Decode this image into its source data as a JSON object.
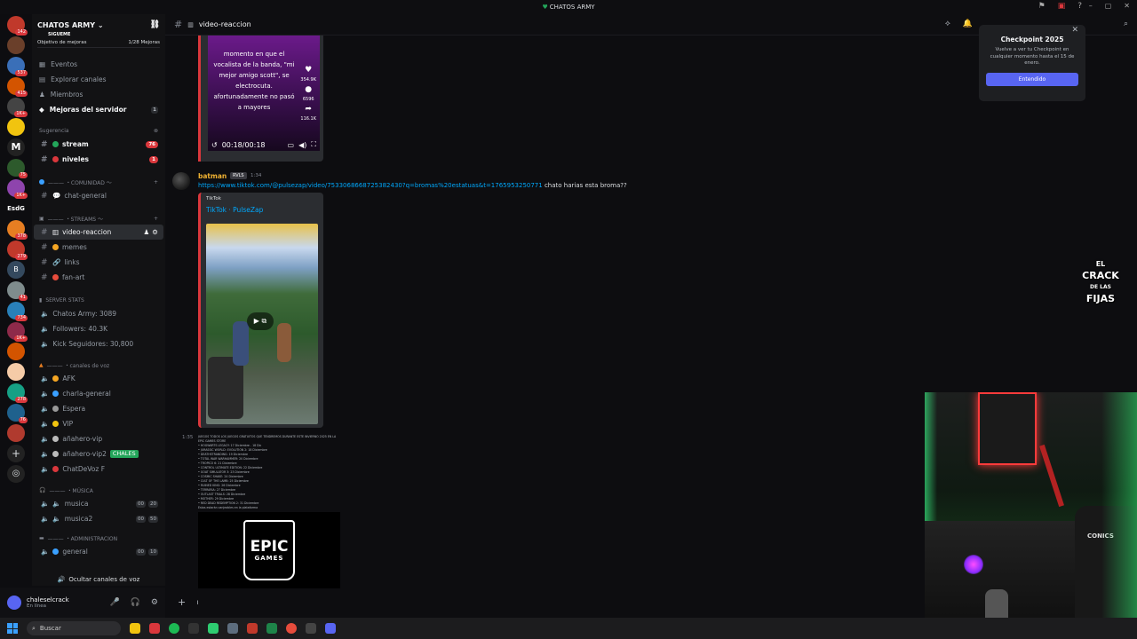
{
  "window": {
    "title": "CHATOS ARMY",
    "title_heart": "♥"
  },
  "server": {
    "name": "CHATOS ARMY",
    "subtitle": "SIGUEME",
    "boost_goal_label": "Objetivo de mejoras",
    "boost_progress": "1/28 Mejoras"
  },
  "rail": {
    "badges": [
      "142",
      "537",
      "415",
      "1K+",
      "1K+",
      "75",
      "1K+",
      "378",
      "279",
      "41",
      "734",
      "1K+",
      "278",
      "76"
    ],
    "text_label": "EsdG"
  },
  "nav": {
    "events": "Eventos",
    "explore": "Explorar canales",
    "members": "Miembros",
    "boosts": "Mejoras del servidor",
    "boosts_count": "1"
  },
  "categories": {
    "suggestion": "Sugerencia",
    "community": "——— ・COMUNIDAD ～",
    "streams": "——— ・STREAMS ～",
    "server_stats": "SERVER STATS",
    "voice": "——— ・canales de voz",
    "music": "——— ・MÚSICA",
    "admin": "——— ・ADMINISTRACION"
  },
  "channels": {
    "stream": "stream",
    "stream_count": "76",
    "niveles": "niveles",
    "niveles_count": "1",
    "chat_general": "chat-general",
    "video_reaccion": "video-reaccion",
    "memes": "memes",
    "links": "links",
    "fan_art": "fan-art",
    "stat_members": "Chatos Army: 3089",
    "stat_followers": "Followers: 40.3K",
    "stat_kick": "Kick Seguidores: 30,800",
    "afk": "AFK",
    "charla_general": "charla-general",
    "espera": "Espera",
    "vip": "VIP",
    "anahero_vip": "añahero-vip",
    "anahero_vip2": "añahero-vip2",
    "chatdevoz": "ChatDeVoz F",
    "musica": "musica",
    "musica_counts": [
      "00",
      "20"
    ],
    "musica2": "musica2",
    "musica2_counts": [
      "00",
      "50"
    ],
    "general": "general",
    "general_counts": [
      "00",
      "10"
    ],
    "chales_badge": "CHALES"
  },
  "hide_voice": "Ocultar canales de voz",
  "user": {
    "name": "chaleselcrack",
    "status": "En línea"
  },
  "chat_header": {
    "channel": "video-reaccion"
  },
  "top_video": {
    "caption": "momento en que el vocalista de la banda, \"mi mejor amigo scott\", se electrocuta. afortunadamente no pasó a mayores",
    "likes": "354.9K",
    "comments": "6596",
    "shares": "116.1K",
    "time": "00:18/00:18"
  },
  "message": {
    "author": "batman",
    "tag": "RVLS",
    "time": "1:34",
    "link": "https://www.tiktok.com/@pulsezap/video/7533068668725382430?q=bromas%20estatuas&t=1765953250771",
    "text": " chato harias esta broma??",
    "embed_provider": "TikTok",
    "embed_title": "TikTok · PulseZap"
  },
  "message2": {
    "time": "1:35",
    "list_lines": [
      "JUEGOS TODOS LOS JUEGOS GRATUITOS QUE TENDREMOS DURANTE ESTE INVIERNO 2025 EN LA EPIC GAMES STORE",
      "• HOGWARTS LEGACY: 17 Diciembre - 18 Dic",
      "• JURASSIC WORLD: EVOLUTION 2: 18 Diciembre",
      "• DEATHSTRANDING: 19 Diciembre",
      "• TOTAL WAR WARHAMMER: 20 Diciembre",
      "• TROPICO 6: 21 Diciembre",
      "• CONTROL ULTIMATE EDITION: 22 Diciembre",
      "• GOAT SIMULATOR 3: 23 Diciembre",
      "• COSMIC SHAKE: 24 Diciembre",
      "• CULT OF THE LAMB: 25 Diciembre",
      "• RUINED KING: 26 Diciembre",
      "• TERRARIA: 27 Diciembre",
      "• OUTLAST TRIALS: 28 Diciembre",
      "• MOTHER: 29 Diciembre",
      "• RED DEAD REDEMPTION 2: 31 Diciembre",
      "Estos estarán canjeables en la plataforma"
    ],
    "epic_line1": "EPIC",
    "epic_line2": "GAMES"
  },
  "popup": {
    "title": "Checkpoint 2025",
    "body": "Vuelve a ver tu Checkpoint en cualquier momento hasta el 15 de enero.",
    "button": "Entendido"
  },
  "overlay_logo": {
    "line1": "EL",
    "line2": "CRACK",
    "line3": "DE LAS",
    "line4": "FIJAS"
  },
  "webcam": {
    "chair_brand": "CONICS"
  },
  "taskbar": {
    "search_placeholder": "Buscar"
  },
  "colors": {
    "accent": "#5865f2",
    "link": "#00a8fc",
    "mention_red": "#da373c",
    "username_gold": "#f0b232"
  }
}
